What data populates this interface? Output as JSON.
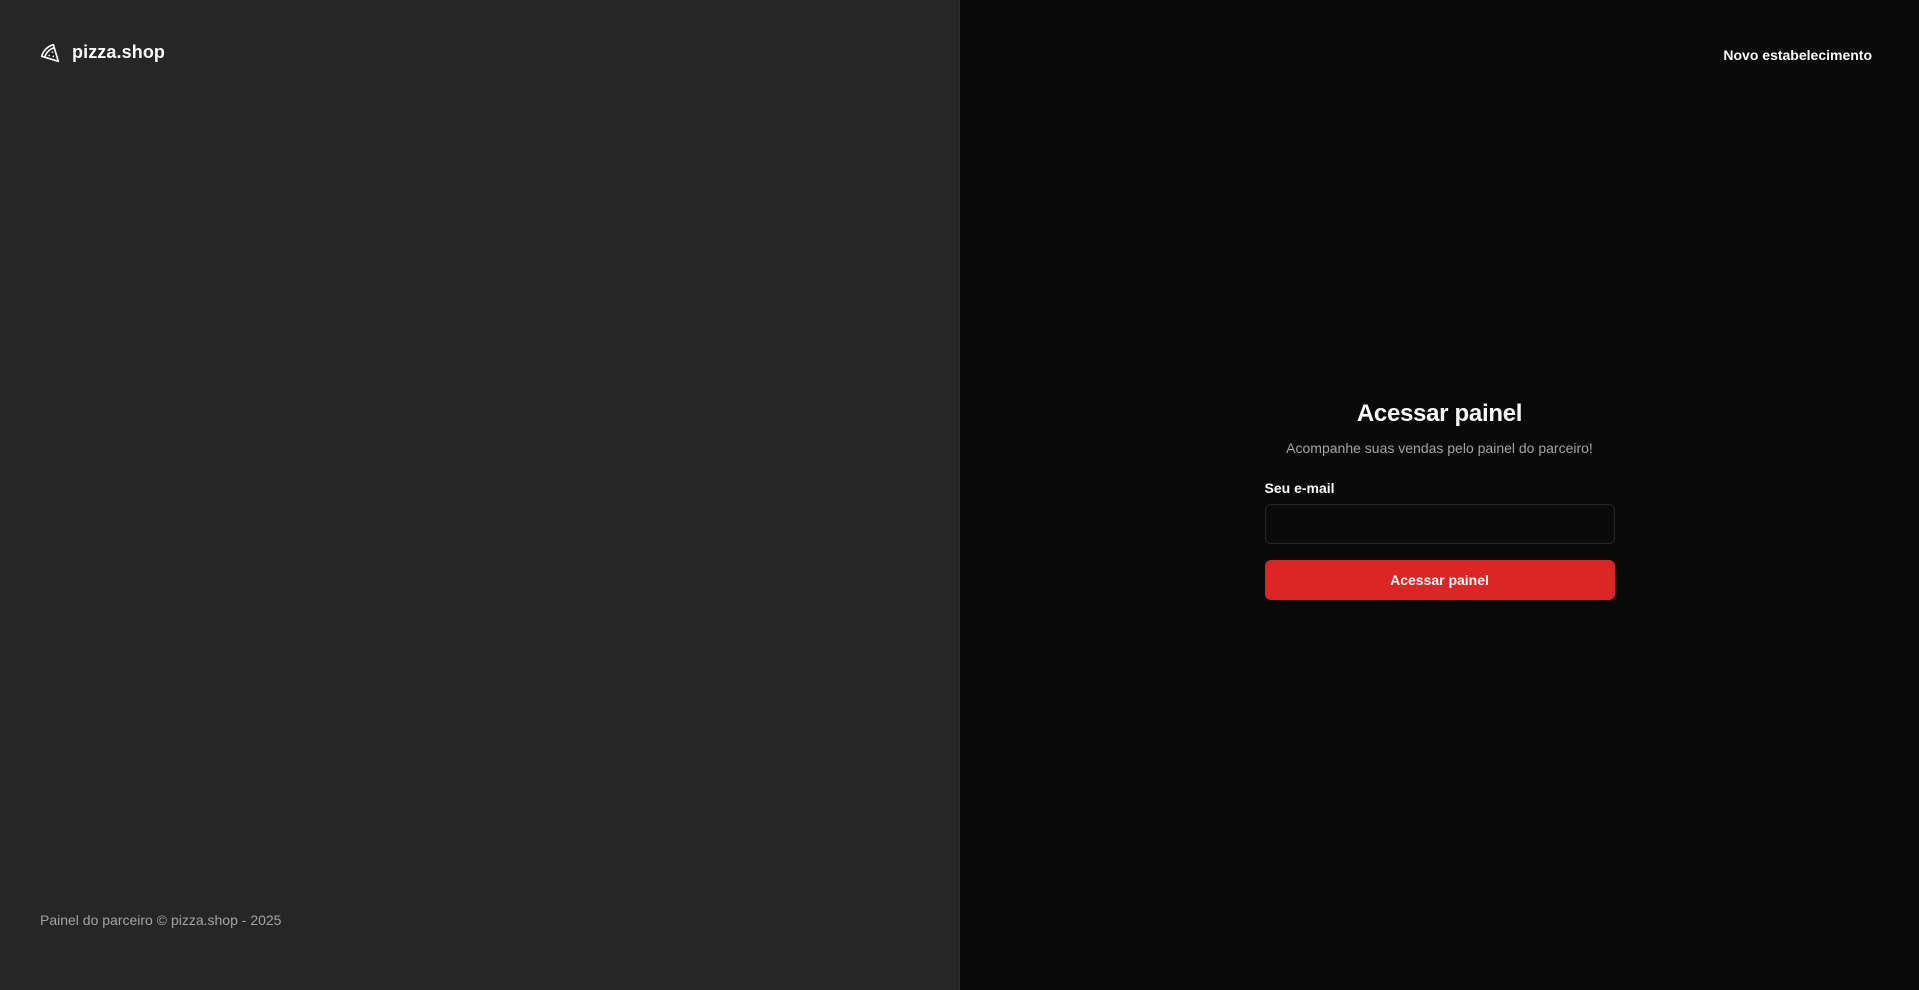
{
  "brand": {
    "name": "pizza.shop",
    "icon": "pizza-icon"
  },
  "footer": {
    "text": "Painel do parceiro © pizza.shop - 2025"
  },
  "header": {
    "new_store_link": "Novo estabelecimento"
  },
  "login": {
    "title": "Acessar painel",
    "subtitle": "Acompanhe suas vendas pelo painel do parceiro!",
    "email_label": "Seu e-mail",
    "email_value": "",
    "email_placeholder": "",
    "submit_label": "Acessar painel"
  },
  "colors": {
    "left_background": "#262626",
    "right_background": "#0a0a0a",
    "accent": "#dc2626",
    "muted_text": "#a3a3a3",
    "foreground": "#fafafa"
  }
}
